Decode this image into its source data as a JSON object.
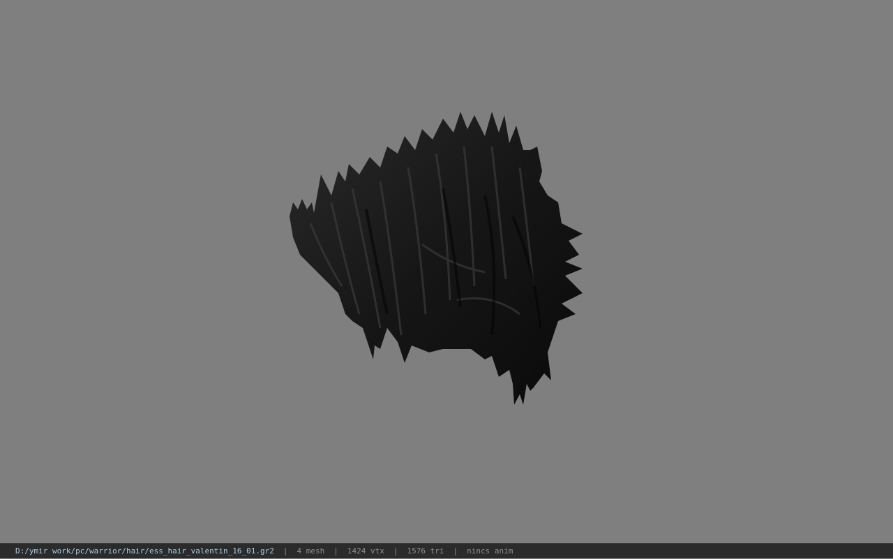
{
  "viewer": {
    "background_color": "#7f7f7f",
    "model": {
      "icon": "hair-mesh-preview",
      "color": "#111111"
    }
  },
  "statusbar": {
    "file_path": "D:/ymir work/pc/warrior/hair/ess_hair_valentin_16_01.gr2",
    "separator": "|",
    "mesh_count": "4 mesh",
    "vertex_count": "1424 vtx",
    "triangle_count": "1576 tri",
    "anim_status": "nincs anim",
    "path_color": "#a8cfe8",
    "bar_color": "#2b2b2b"
  }
}
